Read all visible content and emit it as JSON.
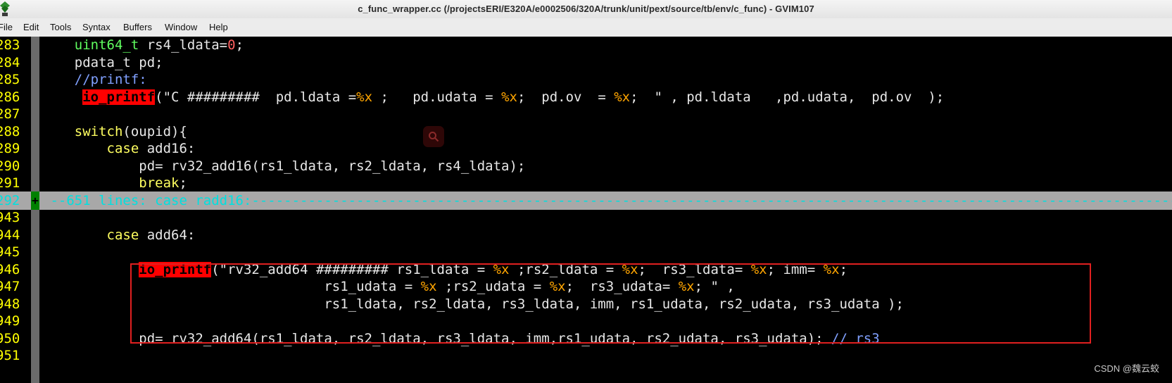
{
  "window": {
    "title": "c_func_wrapper.cc (/projectsERI/E320A/e0002506/320A/trunk/unit/pext/source/tb/env/c_func) - GVIM107"
  },
  "menu": {
    "items": [
      "File",
      "Edit",
      "Tools",
      "Syntax",
      "Buffers",
      "Window",
      "Help"
    ]
  },
  "editor": {
    "lines": [
      {
        "num": "283",
        "segs": [
          {
            "t": "    "
          },
          {
            "t": "uint64_t",
            "c": "type"
          },
          {
            "t": " rs4_ldata="
          },
          {
            "t": "0",
            "c": "num"
          },
          {
            "t": ";"
          }
        ]
      },
      {
        "num": "284",
        "segs": [
          {
            "t": "    pdata_t pd;"
          }
        ]
      },
      {
        "num": "285",
        "segs": [
          {
            "t": "    "
          },
          {
            "t": "//printf:",
            "c": "cmt"
          }
        ]
      },
      {
        "num": "286",
        "segs": [
          {
            "t": "     "
          },
          {
            "t": "io_printf",
            "c": "hl"
          },
          {
            "t": "(\"C #########  pd.ldata ="
          },
          {
            "t": "%x",
            "c": "fmt"
          },
          {
            "t": " ;   pd.udata = "
          },
          {
            "t": "%x",
            "c": "fmt"
          },
          {
            "t": ";  pd.ov  = "
          },
          {
            "t": "%x",
            "c": "fmt"
          },
          {
            "t": ";  \" , pd.ldata   ,pd.udata,  pd.ov  );"
          }
        ]
      },
      {
        "num": "287",
        "segs": []
      },
      {
        "num": "288",
        "segs": [
          {
            "t": "    "
          },
          {
            "t": "switch",
            "c": "kw"
          },
          {
            "t": "(oupid){"
          }
        ]
      },
      {
        "num": "289",
        "segs": [
          {
            "t": "        "
          },
          {
            "t": "case",
            "c": "kw"
          },
          {
            "t": " add16:"
          }
        ]
      },
      {
        "num": "290",
        "segs": [
          {
            "t": "            pd= rv32_add16(rs1_ldata, rs2_ldata, rs4_ldata);"
          }
        ]
      },
      {
        "num": "291",
        "segs": [
          {
            "t": "            "
          },
          {
            "t": "break",
            "c": "kw"
          },
          {
            "t": ";"
          }
        ]
      },
      {
        "num": "292",
        "fold": true,
        "segs": [
          {
            "t": "+--651 lines: case radd16:---------------------------------------------------------------------------------------------------------------------------------------------------------"
          }
        ]
      },
      {
        "num": "943",
        "segs": []
      },
      {
        "num": "944",
        "segs": [
          {
            "t": "        "
          },
          {
            "t": "case",
            "c": "kw"
          },
          {
            "t": " add64:"
          }
        ]
      },
      {
        "num": "945",
        "segs": []
      },
      {
        "num": "946",
        "segs": [
          {
            "t": "            "
          },
          {
            "t": "io_printf",
            "c": "hl"
          },
          {
            "t": "(\"rv32_add64 ######### rs1_ldata = "
          },
          {
            "t": "%x",
            "c": "fmt"
          },
          {
            "t": " ;rs2_ldata = "
          },
          {
            "t": "%x",
            "c": "fmt"
          },
          {
            "t": ";  rs3_ldata= "
          },
          {
            "t": "%x",
            "c": "fmt"
          },
          {
            "t": "; imm= "
          },
          {
            "t": "%x",
            "c": "fmt"
          },
          {
            "t": ";"
          }
        ]
      },
      {
        "num": "947",
        "segs": [
          {
            "t": "                                   rs1_udata = "
          },
          {
            "t": "%x",
            "c": "fmt"
          },
          {
            "t": " ;rs2_udata = "
          },
          {
            "t": "%x",
            "c": "fmt"
          },
          {
            "t": ";  rs3_udata= "
          },
          {
            "t": "%x",
            "c": "fmt"
          },
          {
            "t": "; \" ,"
          }
        ]
      },
      {
        "num": "948",
        "segs": [
          {
            "t": "                                   rs1_ldata, rs2_ldata, rs3_ldata, imm, rs1_udata, rs2_udata, rs3_udata );"
          }
        ]
      },
      {
        "num": "949",
        "segs": []
      },
      {
        "num": "950",
        "segs": [
          {
            "t": "            pd= rv32_add64(rs1_ldata, rs2_ldata, rs3_ldata, imm,rs1_udata, rs2_udata, rs3_udata); "
          },
          {
            "t": "// rs3",
            "c": "cmt"
          }
        ]
      },
      {
        "num": "951",
        "segs": []
      }
    ]
  },
  "watermark": "CSDN @魏云蛟",
  "colors": {
    "linenr": "#ffff00",
    "type": "#60ff60",
    "keyword": "#ffff60",
    "number": "#ff6060",
    "format": "#ffa500",
    "comment": "#80a0ff",
    "search_highlight": "#ff0000",
    "fold_text": "#00e0e0",
    "fold_bg": "#a8a8a8",
    "annotation_box": "#e02020"
  }
}
